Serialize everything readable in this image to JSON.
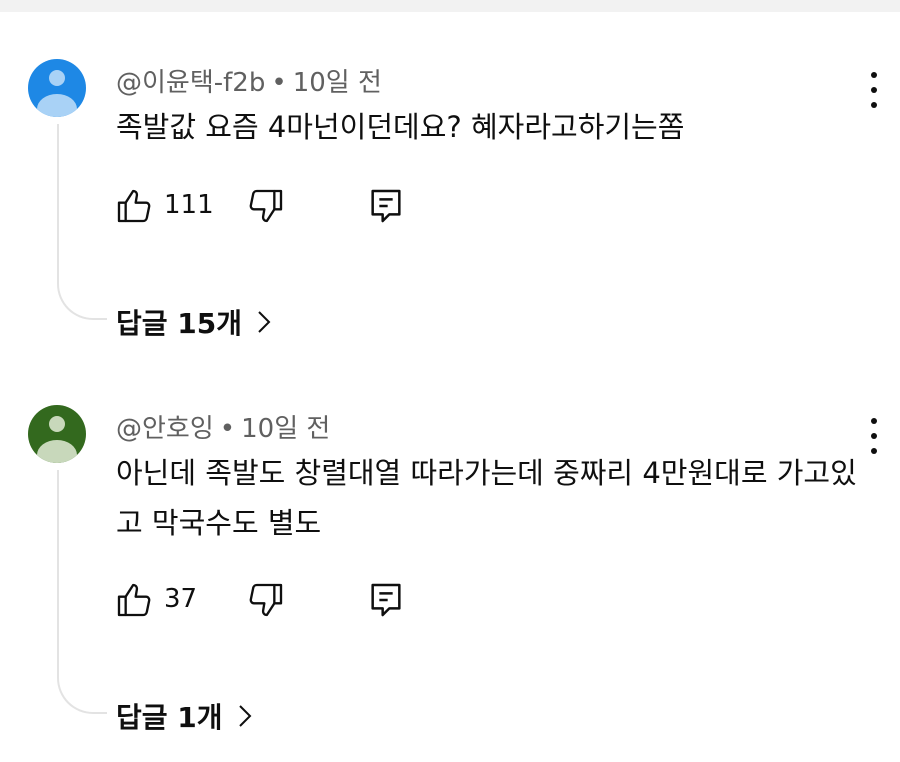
{
  "comments": [
    {
      "author": "@이윤택-f2b",
      "separator": "•",
      "time": "10일 전",
      "text": "족발값 요즘 4마넌이던데요? 혜자라고하기는쫌",
      "likes": "111",
      "replies_label": "답글 15개",
      "avatar_color": "#1e88e5",
      "avatar_figure_color": "#a9d2f6"
    },
    {
      "author": "@안호잉",
      "separator": "•",
      "time": "10일 전",
      "text": "아닌데 족발도 창렬대열 따라가는데 중짜리 4만원대로 가고있고 막국수도 별도",
      "likes": "37",
      "replies_label": "답글 1개",
      "avatar_color": "#33691e",
      "avatar_figure_color": "#c8d8bb"
    }
  ],
  "icons": {
    "like": "thumb-up-icon",
    "dislike": "thumb-down-icon",
    "reply": "comment-reply-icon",
    "more": "more-vert-icon",
    "chevron": "chevron-right-icon"
  }
}
